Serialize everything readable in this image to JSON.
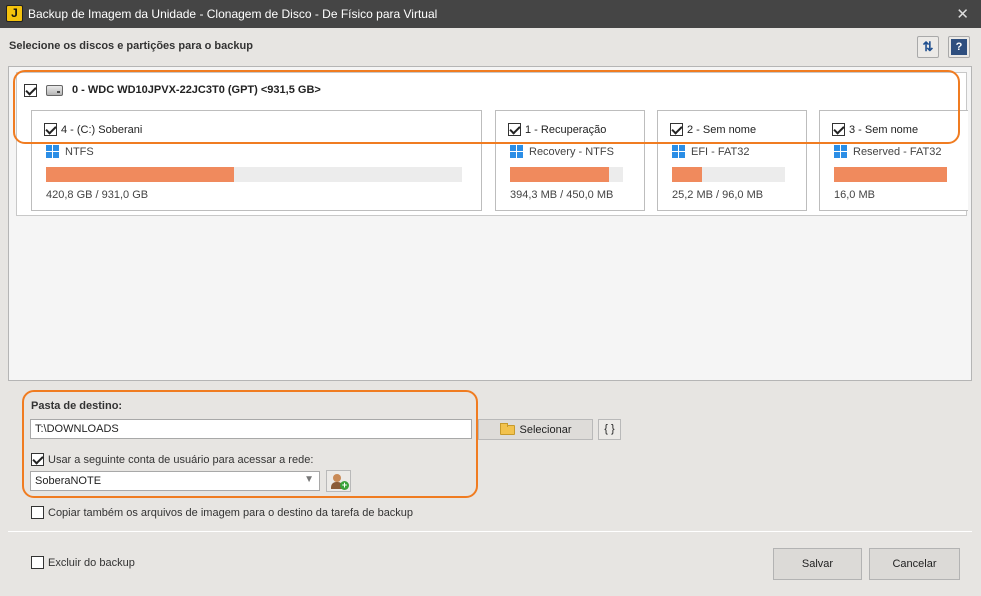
{
  "window": {
    "app_icon": "app-logo-icon",
    "title": "Backup de Imagem da Unidade - Clonagem de Disco - De Físico para Virtual",
    "close_glyph": "✕"
  },
  "header": {
    "label": "Selecione os discos e partições para o backup",
    "refresh_icon": "⇅",
    "help_icon": "?"
  },
  "disk": {
    "checked": true,
    "title": "0 - WDC WD10JPVX-22JC3T0 (GPT) <931,5 GB>",
    "partitions": [
      {
        "label": "4 - (C:) Soberani",
        "fs": "NTFS",
        "used": "420,8 GB / 931,0 GB",
        "usage_fraction": 0.452,
        "checked": true
      },
      {
        "label": "1 -  Recuperação",
        "fs": "Recovery - NTFS",
        "used": "394,3 MB / 450,0 MB",
        "usage_fraction": 0.876,
        "checked": true
      },
      {
        "label": "2 -  Sem nome",
        "fs": "EFI - FAT32",
        "used": "25,2 MB / 96,0 MB",
        "usage_fraction": 0.262,
        "checked": true
      },
      {
        "label": "3 -  Sem nome",
        "fs": "Reserved - FAT32",
        "used": "16,0 MB",
        "usage_fraction": 1.0,
        "checked": true
      }
    ]
  },
  "destination": {
    "label": "Pasta de destino:",
    "path": "T:\\DOWNLOADS",
    "select_button": "Selecionar",
    "braces_button": "{ }",
    "use_account_label": "Usar a seguinte conta de usuário para acessar a rede:",
    "use_account_checked": true,
    "account": "SoberaNOTE",
    "copy_label": "Copiar também os arquivos de imagem para o destino da tarefa de backup",
    "copy_checked": false
  },
  "footer": {
    "exclude_label": "Excluir do backup",
    "exclude_checked": false,
    "save": "Salvar",
    "cancel": "Cancelar"
  },
  "colors": {
    "usage_bar": "#f08a5d",
    "highlight": "#f07c21",
    "titlebar": "#454545"
  }
}
